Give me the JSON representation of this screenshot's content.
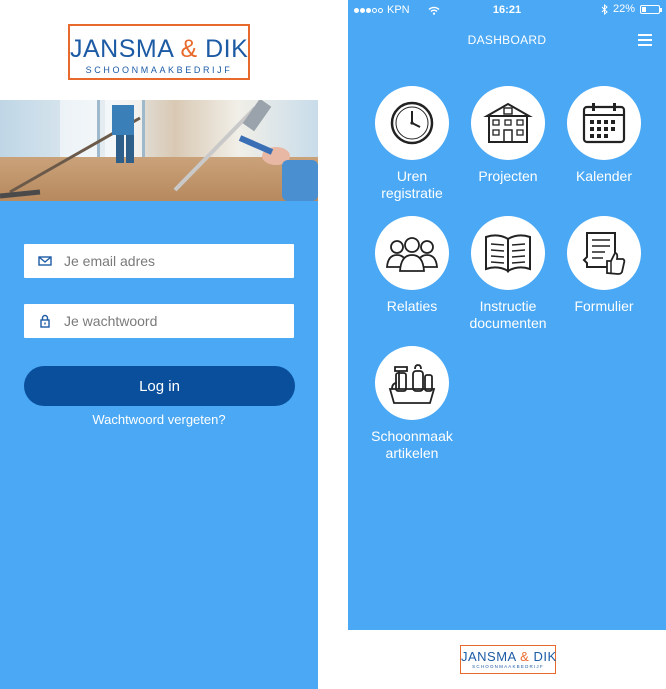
{
  "login": {
    "logo": {
      "brand_left": "JANSMA",
      "brand_amp": "&",
      "brand_right": "DIK",
      "subtitle": "SCHOONMAAKBEDRIJF"
    },
    "email": {
      "placeholder": "Je email adres",
      "value": ""
    },
    "password": {
      "placeholder": "Je wachtwoord",
      "value": ""
    },
    "login_label": "Log in",
    "forgot_label": "Wachtwoord vergeten?"
  },
  "dashboard": {
    "status": {
      "carrier": "KPN",
      "time": "16:21",
      "battery": "22%",
      "battery_level": 0.22
    },
    "title": "DASHBOARD",
    "tiles": [
      {
        "label": "Uren registratie",
        "icon": "clock-icon"
      },
      {
        "label": "Projecten",
        "icon": "building-icon"
      },
      {
        "label": "Kalender",
        "icon": "calendar-icon"
      },
      {
        "label": "Relaties",
        "icon": "people-icon"
      },
      {
        "label": "Instructie documenten",
        "icon": "book-icon"
      },
      {
        "label": "Formulier",
        "icon": "form-thumbs-up-icon"
      },
      {
        "label": "Schoonmaak artikelen",
        "icon": "cleaning-supplies-icon"
      }
    ],
    "footer_logo": {
      "brand_left": "JANSMA",
      "brand_amp": "&",
      "brand_right": "DIK",
      "subtitle": "SCHOONMAAKBEDRIJF"
    }
  },
  "colors": {
    "primary_blue": "#4aa8f4",
    "button_blue": "#0a4f9c",
    "logo_blue": "#1d5ba5",
    "logo_orange": "#e8692c"
  }
}
